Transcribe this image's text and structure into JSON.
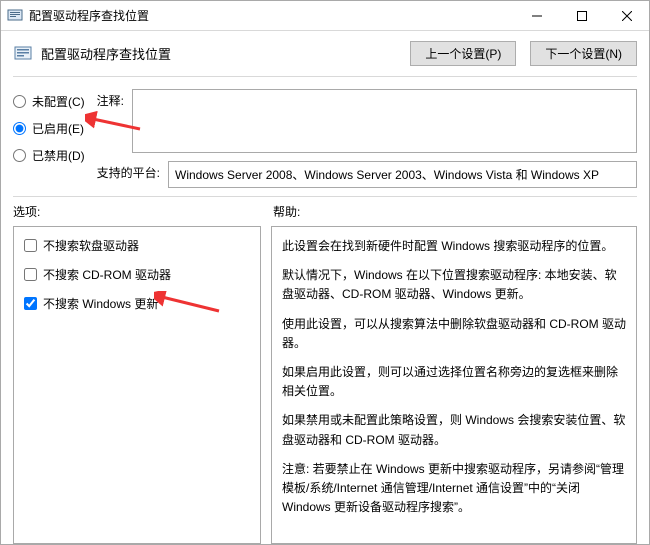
{
  "window": {
    "title": "配置驱动程序查找位置"
  },
  "header": {
    "subtitle": "配置驱动程序查找位置",
    "prev_btn": "上一个设置(P)",
    "next_btn": "下一个设置(N)"
  },
  "radios": {
    "not_configured": "未配置(C)",
    "enabled": "已启用(E)",
    "disabled": "已禁用(D)"
  },
  "fields": {
    "comment_label": "注释:",
    "platform_label": "支持的平台:",
    "platform_value": "Windows Server 2008、Windows Server 2003、Windows Vista 和 Windows XP"
  },
  "section_labels": {
    "options": "选项:",
    "help": "帮助:"
  },
  "options": {
    "cb_floppy": "不搜索软盘驱动器",
    "cb_cdrom": "不搜索 CD-ROM 驱动器",
    "cb_win_update": "不搜索 Windows 更新"
  },
  "help": {
    "p1": "此设置会在找到新硬件时配置 Windows 搜索驱动程序的位置。",
    "p2": "默认情况下，Windows 在以下位置搜索驱动程序: 本地安装、软盘驱动器、CD-ROM 驱动器、Windows 更新。",
    "p3": "使用此设置，可以从搜索算法中删除软盘驱动器和 CD-ROM 驱动器。",
    "p4": "如果启用此设置，则可以通过选择位置名称旁边的复选框来删除相关位置。",
    "p5": "如果禁用或未配置此策略设置，则 Windows 会搜索安装位置、软盘驱动器和 CD-ROM 驱动器。",
    "p6": "注意: 若要禁止在 Windows 更新中搜索驱动程序，另请参阅“管理模板/系统/Internet 通信管理/Internet 通信设置”中的“关闭 Windows 更新设备驱动程序搜索”。"
  }
}
